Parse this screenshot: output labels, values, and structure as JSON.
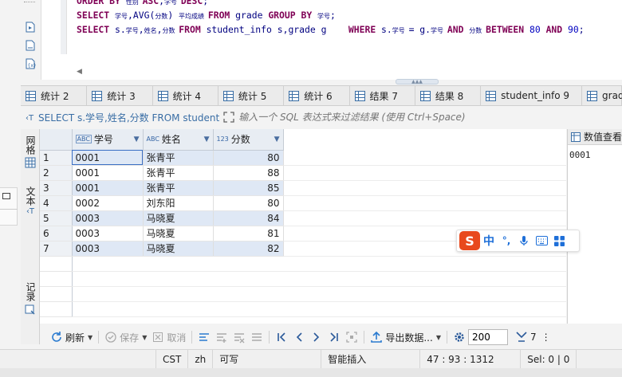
{
  "editor": {
    "lines": [
      [
        {
          "t": "ORDER BY ",
          "c": "kw"
        },
        {
          "t": "性别 ",
          "c": "cn"
        },
        {
          "t": "ASC",
          "c": "kw"
        },
        {
          "t": ",",
          "c": "tx"
        },
        {
          "t": "学号 ",
          "c": "cn"
        },
        {
          "t": "DESC",
          "c": "kw"
        },
        {
          "t": ";",
          "c": "tx"
        }
      ],
      [
        {
          "t": "SELECT ",
          "c": "kw"
        },
        {
          "t": "学号",
          "c": "cn"
        },
        {
          "t": ",AVG(",
          "c": "tx"
        },
        {
          "t": "分数",
          "c": "cn"
        },
        {
          "t": ") ",
          "c": "tx"
        },
        {
          "t": "平均成绩 ",
          "c": "cn"
        },
        {
          "t": "FROM ",
          "c": "kw"
        },
        {
          "t": "grade ",
          "c": "tx"
        },
        {
          "t": "GROUP BY ",
          "c": "kw"
        },
        {
          "t": "学号",
          "c": "cn"
        },
        {
          "t": ";",
          "c": "tx"
        }
      ],
      [
        {
          "t": "SELECT ",
          "c": "kw"
        },
        {
          "t": "s.",
          "c": "tx"
        },
        {
          "t": "学号",
          "c": "cn"
        },
        {
          "t": ",",
          "c": "tx"
        },
        {
          "t": "姓名",
          "c": "cn"
        },
        {
          "t": ",",
          "c": "tx"
        },
        {
          "t": "分数 ",
          "c": "cn"
        },
        {
          "t": "FROM ",
          "c": "kw"
        },
        {
          "t": "student_info s,grade g    ",
          "c": "tx"
        },
        {
          "t": "WHERE ",
          "c": "kw"
        },
        {
          "t": "s.",
          "c": "tx"
        },
        {
          "t": "学号 ",
          "c": "cn"
        },
        {
          "t": "= g.",
          "c": "tx"
        },
        {
          "t": "学号 ",
          "c": "cn"
        },
        {
          "t": "AND ",
          "c": "kw"
        },
        {
          "t": "分数 ",
          "c": "cn"
        },
        {
          "t": "BETWEEN ",
          "c": "kw"
        },
        {
          "t": "80",
          "c": "nm"
        },
        {
          "t": " AND ",
          "c": "kw"
        },
        {
          "t": "90",
          "c": "nm"
        },
        {
          "t": ";",
          "c": "tx"
        }
      ]
    ]
  },
  "tabs": [
    {
      "label": "统计 2"
    },
    {
      "label": "统计 3"
    },
    {
      "label": "统计 4"
    },
    {
      "label": "统计 5"
    },
    {
      "label": "统计 6"
    },
    {
      "label": "结果 7"
    },
    {
      "label": "结果 8"
    },
    {
      "label": "student_info 9"
    },
    {
      "label": "grad"
    }
  ],
  "filter": {
    "query_label": "SELECT s.学号,姓名,分数 FROM student",
    "placeholder": "输入一个 SQL 表达式来过滤结果 (使用 Ctrl+Space)"
  },
  "side": {
    "grid_label": "网格",
    "text_label": "文本",
    "record_label": "记录"
  },
  "grid": {
    "columns": [
      {
        "name": "学号",
        "type": "ABC"
      },
      {
        "name": "姓名",
        "type": "ABC"
      },
      {
        "name": "分数",
        "type": "123"
      }
    ],
    "rows": [
      {
        "n": "1",
        "id": "0001",
        "name": "张青平",
        "score": "80"
      },
      {
        "n": "2",
        "id": "0001",
        "name": "张青平",
        "score": "88"
      },
      {
        "n": "3",
        "id": "0001",
        "name": "张青平",
        "score": "85"
      },
      {
        "n": "4",
        "id": "0002",
        "name": "刘东阳",
        "score": "80"
      },
      {
        "n": "5",
        "id": "0003",
        "name": "马晓夏",
        "score": "84"
      },
      {
        "n": "6",
        "id": "0003",
        "name": "马晓夏",
        "score": "81"
      },
      {
        "n": "7",
        "id": "0003",
        "name": "马晓夏",
        "score": "82"
      }
    ]
  },
  "value_panel": {
    "title": "数值查看",
    "value": "0001"
  },
  "ime": {
    "logo": "S",
    "mode": "中",
    "punct": "°,"
  },
  "toolbar": {
    "refresh": "刷新",
    "save": "保存",
    "cancel": "取消",
    "export": "导出数据...",
    "fetch_size": "200",
    "row_count": "7"
  },
  "status": {
    "timezone": "CST",
    "locale": "zh",
    "writable": "可写",
    "insert_mode": "智能插入",
    "position": "47 : 93 : 1312",
    "selection": "Sel: 0 | 0"
  }
}
